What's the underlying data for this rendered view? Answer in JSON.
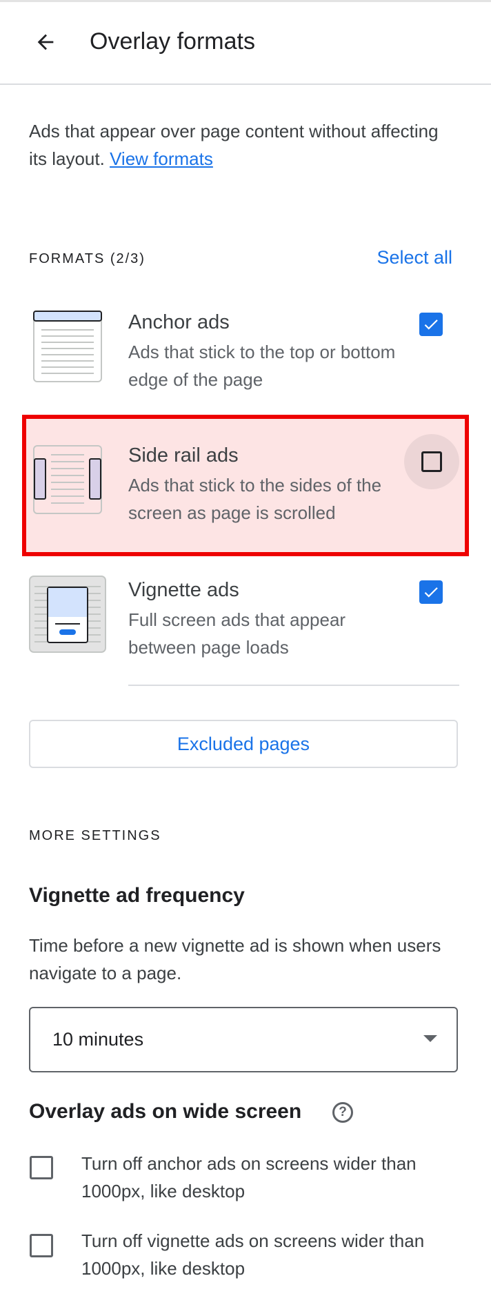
{
  "header": {
    "title": "Overlay formats",
    "back_icon": "arrow-back-icon"
  },
  "intro": {
    "text": "Ads that appear over page content without affecting its layout.",
    "link": "View formats"
  },
  "formats": {
    "label": "FORMATS (2/3)",
    "select_all": "Select all",
    "items": [
      {
        "title": "Anchor ads",
        "desc": "Ads that stick to the top or bottom edge of the page",
        "checked": true
      },
      {
        "title": "Side rail ads",
        "desc": "Ads that stick to the sides of the screen as page is scrolled",
        "checked": false
      },
      {
        "title": "Vignette ads",
        "desc": "Full screen ads that appear between page loads",
        "checked": true
      }
    ]
  },
  "excluded_pages": "Excluded pages",
  "more_settings": {
    "label": "MORE SETTINGS",
    "vignette_frequency": {
      "title": "Vignette ad frequency",
      "help": "Time before a new vignette ad is shown when users navigate to a page.",
      "selected": "10 minutes"
    },
    "wide_screen": {
      "title": "Overlay ads on wide screen",
      "options": [
        {
          "label": "Turn off anchor ads on screens wider than 1000px, like desktop",
          "checked": false
        },
        {
          "label": "Turn off vignette ads on screens wider than 1000px, like desktop",
          "checked": false
        }
      ]
    }
  },
  "colors": {
    "accent": "#1a73e8",
    "highlight_border": "#ee0000",
    "highlight_fill": "#fde4e4"
  }
}
